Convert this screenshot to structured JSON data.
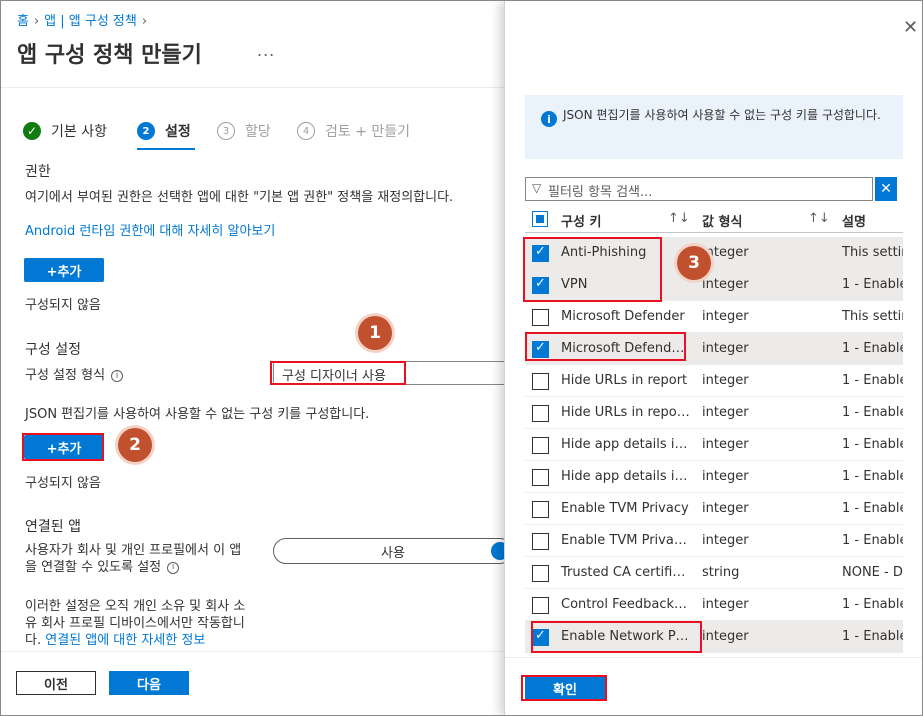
{
  "breadcrumb": {
    "home": "홈",
    "parent": "앱 | 앱 구성 정책"
  },
  "page": {
    "title": "앱 구성 정책 만들기",
    "more": "..."
  },
  "steps": [
    {
      "label": "기본 사항",
      "num": "✓"
    },
    {
      "label": "설정",
      "num": "2"
    },
    {
      "label": "할당",
      "num": "3"
    },
    {
      "label": "검토 + 만들기",
      "num": "4"
    }
  ],
  "permissions": {
    "heading": "권한",
    "description": "여기에서 부여된 권한은 선택한 앱에 대한 \"기본 앱 권한\" 정책을 재정의합니다.",
    "link": "Android 런타임 권한에 대해 자세히 알아보기",
    "add_label": "+추가",
    "status": "구성되지 않음"
  },
  "config": {
    "heading": "구성 설정",
    "format_label": "구성 설정 형식",
    "format_value": "구성 디자이너 사용",
    "json_desc": "JSON 편집기를 사용하여 사용할 수 없는 구성 키를 구성합니다.",
    "add_label": "+추가",
    "status": "구성되지 않음"
  },
  "connected": {
    "heading": "연결된 앱",
    "desc_line1": "사용자가 회사 및 개인 프로필에서 이 앱",
    "desc_line2": "을 연결할 수 있도록 설정",
    "toggle_label": "사용",
    "note_line1": "이러한 설정은 오직 개인 소유 및 회사 소",
    "note_line2": "유 회사 프로필 디바이스에서만 작동합니",
    "note_prefix": "다. ",
    "note_link": "연결된 앱에 대한 자세한 정보"
  },
  "footer": {
    "prev": "이전",
    "next": "다음"
  },
  "panel": {
    "info": "JSON 편집기를 사용하여 사용할 수 없는 구성 키를 구성합니다.",
    "filter_placeholder": "필터링 항목 검색...",
    "columns": {
      "key": "구성 키",
      "type": "값 형식",
      "desc": "설명"
    },
    "rows": [
      {
        "key": "Anti-Phishing",
        "type": "integer",
        "desc": "This settin",
        "checked": true
      },
      {
        "key": "VPN",
        "type": "integer",
        "desc": "1 - Enable",
        "checked": true
      },
      {
        "key": "Microsoft Defender",
        "type": "integer",
        "desc": "This settin",
        "checked": false
      },
      {
        "key": "Microsoft Defender ...",
        "type": "integer",
        "desc": "1 - Enable",
        "checked": true
      },
      {
        "key": "Hide URLs in report",
        "type": "integer",
        "desc": "1 - Enable",
        "checked": false
      },
      {
        "key": "Hide URLs in report...",
        "type": "integer",
        "desc": "1 - Enable",
        "checked": false
      },
      {
        "key": "Hide app details in r...",
        "type": "integer",
        "desc": "1 - Enable",
        "checked": false
      },
      {
        "key": "Hide app details in r...",
        "type": "integer",
        "desc": "1 - Enable",
        "checked": false
      },
      {
        "key": "Enable TVM Privacy",
        "type": "integer",
        "desc": "1 - Enable",
        "checked": false
      },
      {
        "key": "Enable TVM Privacy ...",
        "type": "integer",
        "desc": "1 - Enable",
        "checked": false
      },
      {
        "key": "Trusted CA certificat...",
        "type": "string",
        "desc": "NONE - D",
        "checked": false
      },
      {
        "key": "Control Feedback S...",
        "type": "integer",
        "desc": "1 - Enable",
        "checked": false
      },
      {
        "key": "Enable Network Pro...",
        "type": "integer",
        "desc": "1 - Enable",
        "checked": true
      }
    ],
    "ok_label": "확인"
  },
  "callouts": [
    "1",
    "2",
    "3"
  ]
}
